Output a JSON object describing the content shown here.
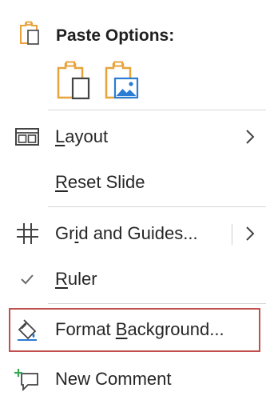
{
  "paste_options": {
    "title": "Paste Options:"
  },
  "menu": {
    "layout": {
      "pre": "",
      "key": "L",
      "post": "ayout"
    },
    "reset_slide": {
      "pre": "",
      "key": "R",
      "post": "eset Slide"
    },
    "grid_guides": {
      "pre": "Gr",
      "key": "i",
      "post": "d and Guides..."
    },
    "ruler": {
      "pre": "",
      "key": "R",
      "post": "uler"
    },
    "format_background": {
      "pre": "Format ",
      "key": "B",
      "post": "ackground..."
    },
    "new_comment": {
      "pre": "New Comment",
      "key": "",
      "post": ""
    }
  },
  "colors": {
    "accent": "#e8a33d",
    "highlight": "#c0504d",
    "icon_blue": "#2b7cd3",
    "icon_green": "#3aa757"
  }
}
